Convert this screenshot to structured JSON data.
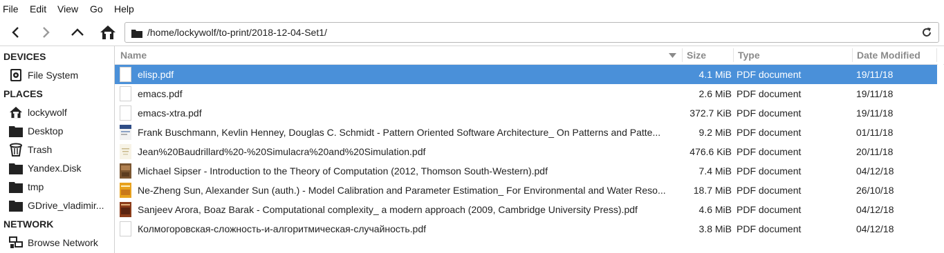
{
  "menu": [
    "File",
    "Edit",
    "View",
    "Go",
    "Help"
  ],
  "location": {
    "path": "/home/lockywolf/to-print/2018-12-04-Set1/"
  },
  "sidebar": {
    "devices_heading": "DEVICES",
    "devices": [
      {
        "label": "File System",
        "icon": "drive-icon"
      }
    ],
    "places_heading": "PLACES",
    "places": [
      {
        "label": "lockywolf",
        "icon": "home-icon"
      },
      {
        "label": "Desktop",
        "icon": "folder-icon"
      },
      {
        "label": "Trash",
        "icon": "trash-icon"
      },
      {
        "label": "Yandex.Disk",
        "icon": "folder-icon"
      },
      {
        "label": "tmp",
        "icon": "folder-icon"
      },
      {
        "label": "GDrive_vladimir...",
        "icon": "folder-icon"
      }
    ],
    "network_heading": "NETWORK",
    "network": [
      {
        "label": "Browse Network",
        "icon": "network-icon"
      }
    ]
  },
  "columns": {
    "name": "Name",
    "size": "Size",
    "type": "Type",
    "date": "Date Modified"
  },
  "files": [
    {
      "name": "elisp.pdf",
      "size": "4.1 MiB",
      "type": "PDF document",
      "date": "19/11/18",
      "selected": true,
      "thumb": "blank"
    },
    {
      "name": "emacs.pdf",
      "size": "2.6 MiB",
      "type": "PDF document",
      "date": "19/11/18",
      "thumb": "blank"
    },
    {
      "name": "emacs-xtra.pdf",
      "size": "372.7 KiB",
      "type": "PDF document",
      "date": "19/11/18",
      "thumb": "blank"
    },
    {
      "name": "Frank Buschmann, Kevlin Henney, Douglas C. Schmidt - Pattern Oriented Software Architecture_ On Patterns and Patte...",
      "size": "9.2 MiB",
      "type": "PDF document",
      "date": "01/11/18",
      "thumb": "cover-blue"
    },
    {
      "name": "Jean%20Baudrillard%20-%20Simulacra%20and%20Simulation.pdf",
      "size": "476.6 KiB",
      "type": "PDF document",
      "date": "20/11/18",
      "thumb": "cover-light"
    },
    {
      "name": "Michael Sipser - Introduction to the Theory of Computation (2012, Thomson South-Western).pdf",
      "size": "7.4 MiB",
      "type": "PDF document",
      "date": "04/12/18",
      "thumb": "cover-brown"
    },
    {
      "name": "Ne-Zheng Sun, Alexander Sun (auth.) - Model Calibration and Parameter Estimation_ For Environmental and Water Reso...",
      "size": "18.7 MiB",
      "type": "PDF document",
      "date": "26/10/18",
      "thumb": "cover-orange"
    },
    {
      "name": "Sanjeev Arora, Boaz Barak - Computational complexity_ a modern approach (2009, Cambridge University Press).pdf",
      "size": "4.6 MiB",
      "type": "PDF document",
      "date": "04/12/18",
      "thumb": "cover-dark"
    },
    {
      "name": "Колмогоровская-сложность-и-алгоритмическая-случайность.pdf",
      "size": "3.8 MiB",
      "type": "PDF document",
      "date": "04/12/18",
      "thumb": "blank"
    }
  ],
  "colors": {
    "selection": "#4a90d9",
    "header_text": "#8a8a8a"
  }
}
